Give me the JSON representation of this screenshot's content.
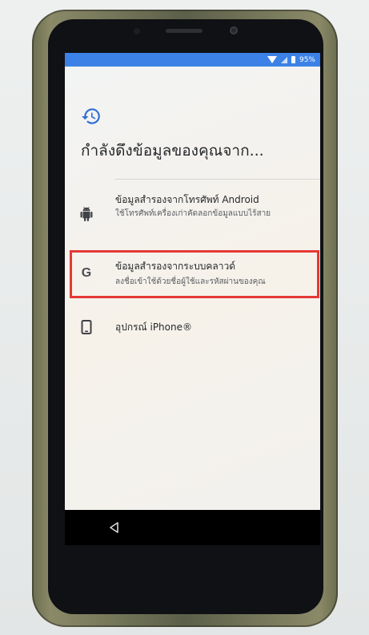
{
  "status_bar": {
    "battery": "95%",
    "icons": [
      "wifi-icon",
      "signal-icon",
      "battery-icon"
    ]
  },
  "header": {
    "icon": "history-icon",
    "title": "กำลังดึงข้อมูลของคุณจาก..."
  },
  "options": [
    {
      "icon": "android-icon",
      "title": "ข้อมูลสำรองจากโทรศัพท์ Android",
      "subtitle": "ใช้โทรศัพท์เครื่องเก่าคัดลอกข้อมูลแบบไร้สาย"
    },
    {
      "icon": "google-icon",
      "title": "ข้อมูลสำรองจากระบบคลาวด์",
      "subtitle": "ลงชื่อเข้าใช้ด้วยชื่อผู้ใช้และรหัสผ่านของคุณ",
      "highlighted": true
    },
    {
      "icon": "phone-icon",
      "title": "อุปกรณ์ iPhone®",
      "subtitle": ""
    }
  ],
  "google_letter": "G",
  "nav": {
    "back_icon": "back-triangle-icon"
  },
  "colors": {
    "status_bar": "#3c82e6",
    "accent_icon": "#2f6fd6",
    "highlight": "#e53935",
    "text_primary": "#26282b",
    "text_secondary": "#5b5e63"
  }
}
